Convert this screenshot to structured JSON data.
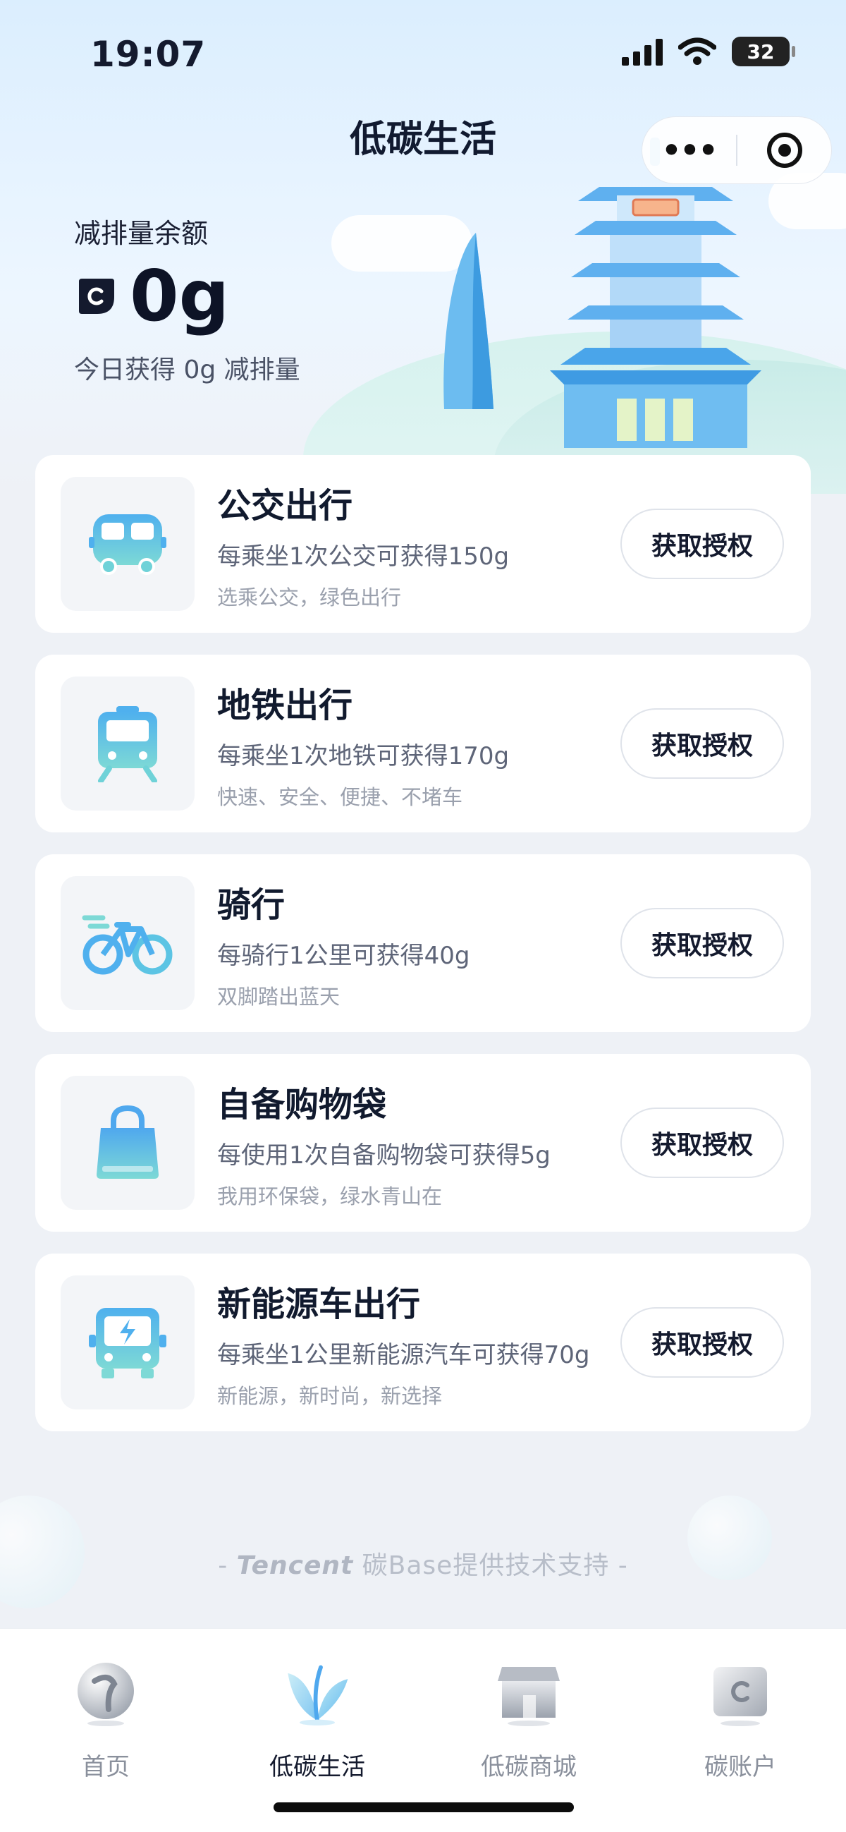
{
  "status": {
    "time": "19:07",
    "battery": "32"
  },
  "header": {
    "title": "低碳生活"
  },
  "balance": {
    "label": "减排量余额",
    "value": "0g",
    "today": "今日获得 0g 减排量"
  },
  "cards": [
    {
      "title": "公交出行",
      "desc": "每乘坐1次公交可获得150g",
      "sub": "选乘公交，绿色出行",
      "button": "获取授权",
      "icon": "bus-icon"
    },
    {
      "title": "地铁出行",
      "desc": "每乘坐1次地铁可获得170g",
      "sub": "快速、安全、便捷、不堵车",
      "button": "获取授权",
      "icon": "subway-icon"
    },
    {
      "title": "骑行",
      "desc": "每骑行1公里可获得40g",
      "sub": "双脚踏出蓝天",
      "button": "获取授权",
      "icon": "bicycle-icon"
    },
    {
      "title": "自备购物袋",
      "desc": "每使用1次自备购物袋可获得5g",
      "sub": "我用环保袋，绿水青山在",
      "button": "获取授权",
      "icon": "shopping-bag-icon"
    },
    {
      "title": "新能源车出行",
      "desc": "每乘坐1公里新能源汽车可获得70g",
      "sub": "新能源，新时尚，新选择",
      "button": "获取授权",
      "icon": "electric-car-icon"
    }
  ],
  "footer": {
    "brand": "Tencent",
    "credit_prefix": "- ",
    "credit_text": " 碳Base提供技术支持 -"
  },
  "tabs": [
    {
      "label": "首页",
      "icon": "home-globe-icon"
    },
    {
      "label": "低碳生活",
      "icon": "leaf-icon"
    },
    {
      "label": "低碳商城",
      "icon": "store-icon"
    },
    {
      "label": "碳账户",
      "icon": "wallet-icon"
    }
  ],
  "colors": {
    "accent": "#4fb3ee",
    "accent_light": "#7dd9d6",
    "text": "#141a2e"
  }
}
